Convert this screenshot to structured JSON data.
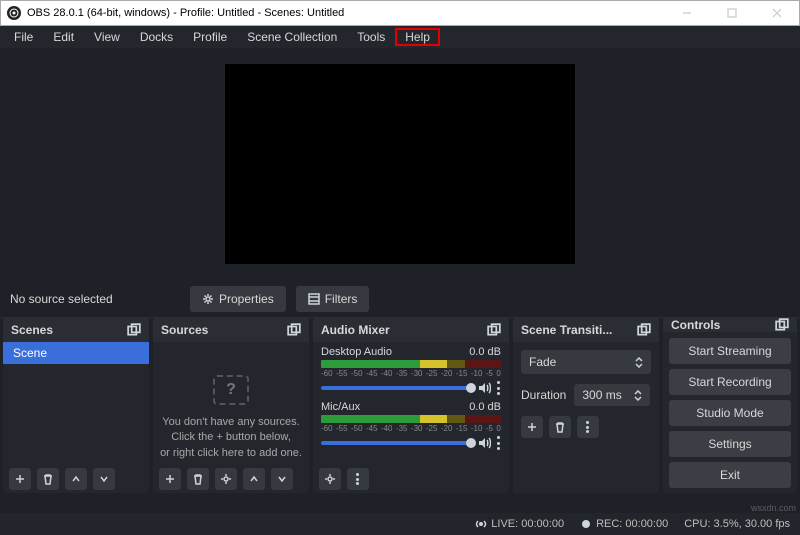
{
  "title": "OBS 28.0.1 (64-bit, windows) - Profile: Untitled - Scenes: Untitled",
  "menu": {
    "file": "File",
    "edit": "Edit",
    "view": "View",
    "docks": "Docks",
    "profile": "Profile",
    "scene_collection": "Scene Collection",
    "tools": "Tools",
    "help": "Help"
  },
  "info": {
    "no_source": "No source selected",
    "properties": "Properties",
    "filters": "Filters"
  },
  "scenes": {
    "title": "Scenes",
    "items": [
      "Scene"
    ]
  },
  "sources": {
    "title": "Sources",
    "empty1": "You don't have any sources.",
    "empty2": "Click the + button below,",
    "empty3": "or right click here to add one.",
    "qmark": "?"
  },
  "mixer": {
    "title": "Audio Mixer",
    "ch": [
      {
        "name": "Desktop Audio",
        "level": "0.0 dB",
        "ticks": [
          "-60",
          "-55",
          "-50",
          "-45",
          "-40",
          "-35",
          "-30",
          "-25",
          "-20",
          "-15",
          "-10",
          "-5",
          "0"
        ]
      },
      {
        "name": "Mic/Aux",
        "level": "0.0 dB",
        "ticks": [
          "-60",
          "-55",
          "-50",
          "-45",
          "-40",
          "-35",
          "-30",
          "-25",
          "-20",
          "-15",
          "-10",
          "-5",
          "0"
        ]
      }
    ]
  },
  "transitions": {
    "title": "Scene Transiti...",
    "selected": "Fade",
    "duration_label": "Duration",
    "duration_value": "300 ms"
  },
  "controls": {
    "title": "Controls",
    "start_streaming": "Start Streaming",
    "start_recording": "Start Recording",
    "studio_mode": "Studio Mode",
    "settings": "Settings",
    "exit": "Exit"
  },
  "status": {
    "live": "LIVE: 00:00:00",
    "rec": "REC: 00:00:00",
    "cpu": "CPU: 3.5%, 30.00 fps"
  },
  "watermark": "wsxdn.com"
}
